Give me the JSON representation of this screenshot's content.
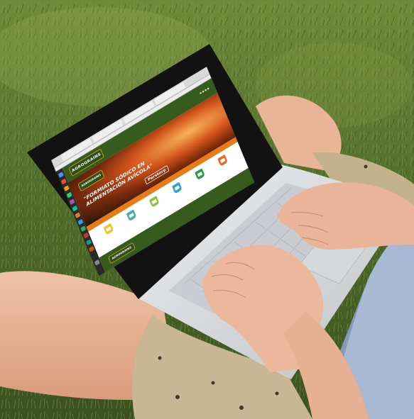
{
  "scene": {
    "palette": {
      "grass_dark": "#3f5a22",
      "grass_light": "#7f9a44",
      "skin": "#e9b699",
      "shorts": "#c3b091",
      "shirt": "#9fb3cf",
      "laptop_silver": "#d9dbdd"
    }
  },
  "website": {
    "logo_text": "AGROGRAINS",
    "hero_logo_text": "AGROGRAINS",
    "hero_title": "\"FORMIATO SÓDICO EN ALIMENTACIÓN AVÍCOLA\"",
    "hero_brand": "Perstorp",
    "footer_logo_text": "AGROGRAINS",
    "colors": {
      "header": "#355b1d",
      "accent_orange": "#e97b16",
      "products_bg": "#ffffff"
    },
    "products": [
      {
        "color": "#f3c524",
        "icon": "bucket-icon"
      },
      {
        "color": "#3fb0a2",
        "icon": "bucket-icon"
      },
      {
        "color": "#8cc63f",
        "icon": "bucket-icon"
      },
      {
        "color": "#29a3d9",
        "icon": "bucket-icon"
      },
      {
        "color": "#2f9b45",
        "icon": "bucket-icon"
      },
      {
        "color": "#e66a1e",
        "icon": "bucket-icon"
      }
    ]
  }
}
